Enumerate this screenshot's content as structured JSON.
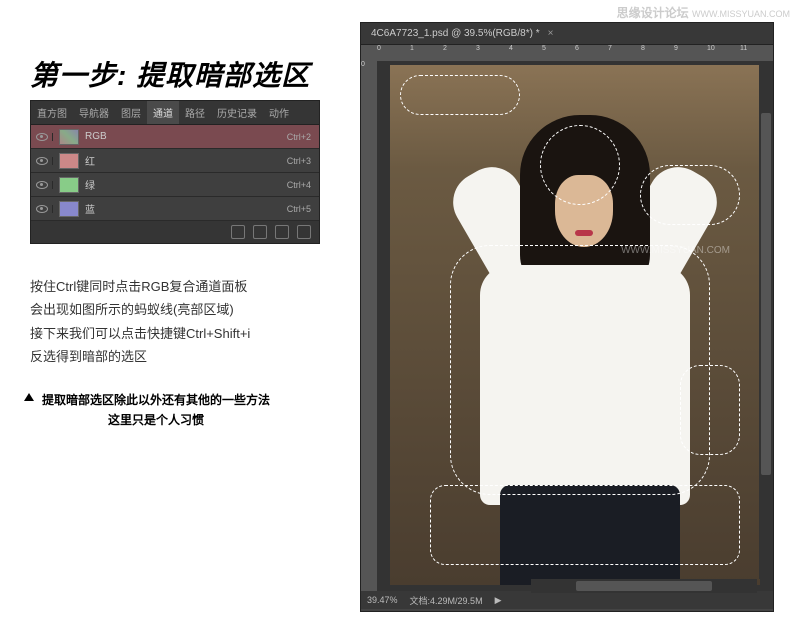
{
  "watermark": {
    "site": "思缘设计论坛",
    "url": "WWW.MISSYUAN.COM"
  },
  "step": {
    "title": "第一步:  提取暗部选区"
  },
  "channels_panel": {
    "tabs": [
      "直方图",
      "导航器",
      "图层",
      "通道",
      "路径",
      "历史记录",
      "动作"
    ],
    "active_tab_index": 3,
    "rows": [
      {
        "name": "RGB",
        "shortcut": "Ctrl+2",
        "selected": true,
        "thumb": "rgb"
      },
      {
        "name": "红",
        "shortcut": "Ctrl+3",
        "selected": false,
        "thumb": "r"
      },
      {
        "name": "绿",
        "shortcut": "Ctrl+4",
        "selected": false,
        "thumb": "g"
      },
      {
        "name": "蓝",
        "shortcut": "Ctrl+5",
        "selected": false,
        "thumb": "b"
      }
    ]
  },
  "instructions": {
    "line1": "按住Ctrl键同时点击RGB复合通道面板",
    "line2": "会出现如图所示的蚂蚁线(亮部区域)",
    "line3": "接下来我们可以点击快捷键Ctrl+Shift+i",
    "line4": "反选得到暗部的选区"
  },
  "sub_note": {
    "line1": "提取暗部选区除此以外还有其他的一些方法",
    "line2": "这里只是个人习惯"
  },
  "ps_window": {
    "tab_title": "4C6A7723_1.psd @ 39.5%(RGB/8*) *",
    "ruler_h": [
      "0",
      "1",
      "2",
      "3",
      "4",
      "5",
      "6",
      "7",
      "8",
      "9",
      "10",
      "11"
    ],
    "ruler_v": [
      "0",
      "",
      "",
      "",
      "",
      "",
      "",
      "",
      ""
    ],
    "status": {
      "zoom": "39.47%",
      "doc": "文档:4.29M/29.5M"
    }
  }
}
